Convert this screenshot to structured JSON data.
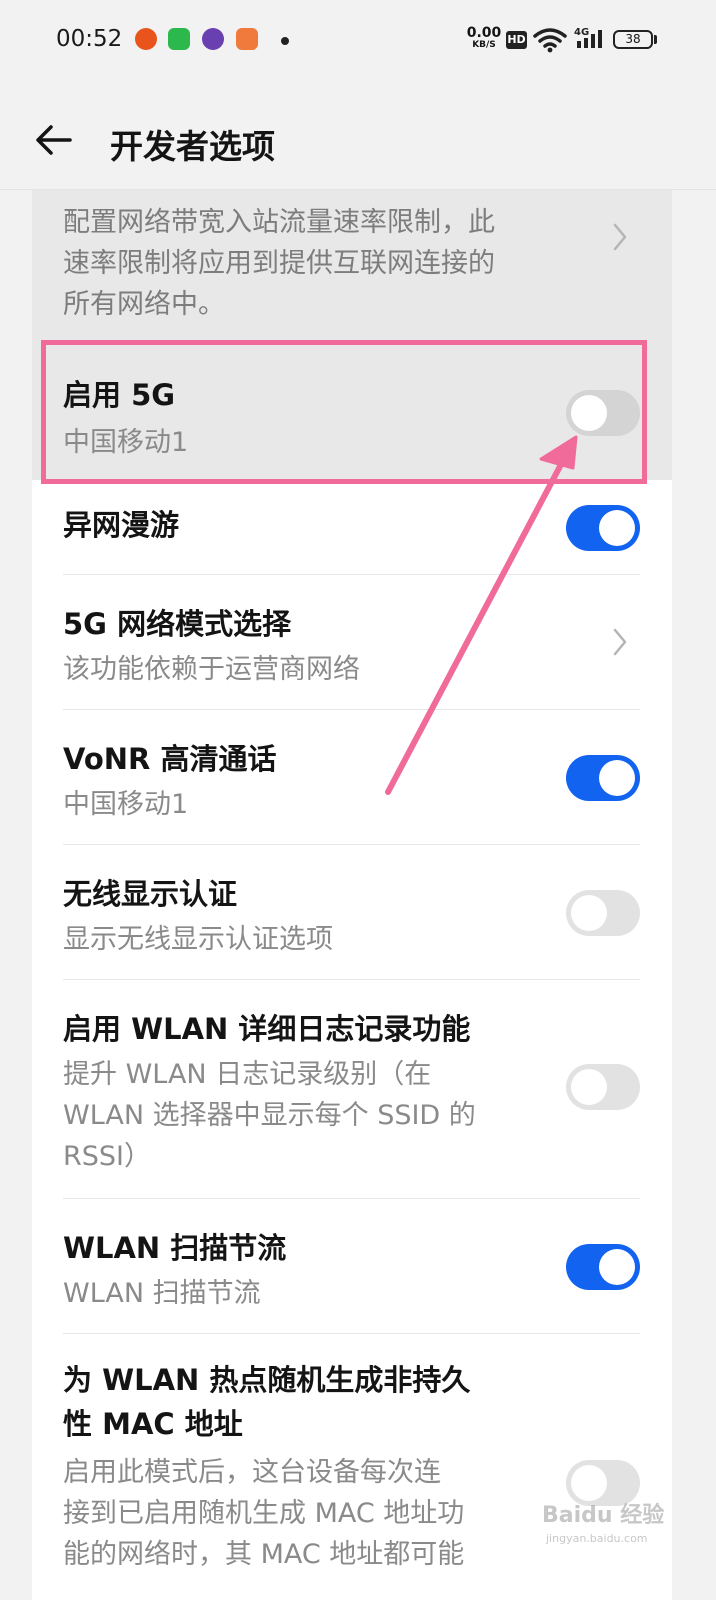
{
  "status_bar": {
    "time": "00:52",
    "net_speed_value": "0.00",
    "net_speed_unit": "KB/S",
    "hd_label": "HD",
    "network_label": "4G",
    "battery_level": "38"
  },
  "header": {
    "back_icon": "arrow-left-icon",
    "title": "开发者选项"
  },
  "settings": [
    {
      "subtitle": "配置网络带宽入站流量速率限制，此\n速率限制将应用到提供互联网连接的\n所有网络中。",
      "control": "chevron"
    },
    {
      "title": "启用 5G",
      "subtitle": "中国移动1",
      "control": "toggle",
      "on": false
    },
    {
      "title": "异网漫游",
      "control": "toggle",
      "on": true
    },
    {
      "title": "5G 网络模式选择",
      "subtitle": "该功能依赖于运营商网络",
      "control": "chevron"
    },
    {
      "title": "VoNR 高清通话",
      "subtitle": "中国移动1",
      "control": "toggle",
      "on": true
    },
    {
      "title": "无线显示认证",
      "subtitle": "显示无线显示认证选项",
      "control": "toggle",
      "on": false
    },
    {
      "title": "启用 WLAN 详细日志记录功能",
      "subtitle": "提升 WLAN 日志记录级别（在\nWLAN 选择器中显示每个 SSID 的\nRSSI）",
      "control": "toggle",
      "on": false
    },
    {
      "title": "WLAN 扫描节流",
      "subtitle": "WLAN 扫描节流",
      "control": "toggle",
      "on": true
    },
    {
      "title": "为 WLAN 热点随机生成非持久\n性 MAC 地址",
      "subtitle": "启用此模式后，这台设备每次连\n接到已启用随机生成 MAC 地址功\n能的网络时，其 MAC 地址都可能",
      "control": "toggle",
      "on": false
    }
  ],
  "colors": {
    "toggle_on": "#1263f0",
    "toggle_off": "#e2e2e2",
    "annotation": "#f06a9a"
  },
  "watermark": {
    "text": "Baidu 经验",
    "url": "jingyan.baidu.com"
  }
}
